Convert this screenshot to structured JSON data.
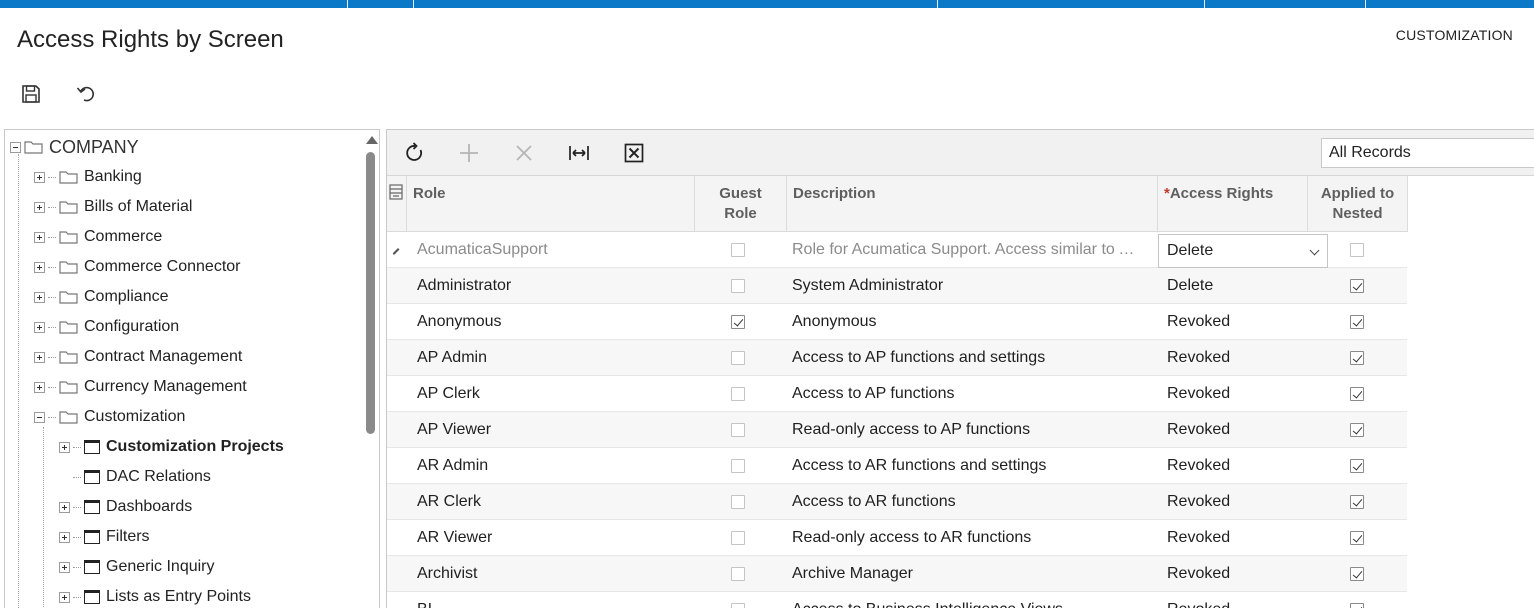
{
  "page": {
    "title": "Access Rights by Screen",
    "customization_label": "CUSTOMIZATION"
  },
  "tree": {
    "root": "COMPANY",
    "items": [
      {
        "label": "Banking"
      },
      {
        "label": "Bills of Material"
      },
      {
        "label": "Commerce"
      },
      {
        "label": "Commerce Connector"
      },
      {
        "label": "Compliance"
      },
      {
        "label": "Configuration"
      },
      {
        "label": "Contract Management"
      },
      {
        "label": "Currency Management"
      },
      {
        "label": "Customization"
      },
      {
        "label": "Customization Projects"
      },
      {
        "label": "DAC Relations"
      },
      {
        "label": "Dashboards"
      },
      {
        "label": "Filters"
      },
      {
        "label": "Generic Inquiry"
      },
      {
        "label": "Lists as Entry Points"
      }
    ]
  },
  "grid": {
    "filter": "All Records",
    "columns": {
      "role": "Role",
      "guest_role": "Guest Role",
      "description": "Description",
      "access_rights": "Access Rights",
      "applied_to_nested": "Applied to Nested"
    },
    "rows": [
      {
        "role": "AcumaticaSupport",
        "guest": false,
        "description": "Role for Acumatica Support. Access similar to Administrator",
        "access": "Delete",
        "nested": false
      },
      {
        "role": "Administrator",
        "guest": false,
        "description": "System Administrator",
        "access": "Delete",
        "nested": true
      },
      {
        "role": "Anonymous",
        "guest": true,
        "description": "Anonymous",
        "access": "Revoked",
        "nested": true
      },
      {
        "role": "AP Admin",
        "guest": false,
        "description": "Access to AP functions and settings",
        "access": "Revoked",
        "nested": true
      },
      {
        "role": "AP Clerk",
        "guest": false,
        "description": "Access to AP functions",
        "access": "Revoked",
        "nested": true
      },
      {
        "role": "AP Viewer",
        "guest": false,
        "description": "Read-only access to AP functions",
        "access": "Revoked",
        "nested": true
      },
      {
        "role": "AR Admin",
        "guest": false,
        "description": "Access to AR functions and settings",
        "access": "Revoked",
        "nested": true
      },
      {
        "role": "AR Clerk",
        "guest": false,
        "description": "Access to AR functions",
        "access": "Revoked",
        "nested": true
      },
      {
        "role": "AR Viewer",
        "guest": false,
        "description": "Read-only access to AR functions",
        "access": "Revoked",
        "nested": true
      },
      {
        "role": "Archivist",
        "guest": false,
        "description": "Archive Manager",
        "access": "Revoked",
        "nested": true
      },
      {
        "role": "BI",
        "guest": false,
        "description": "Access to Business Intelligence Views",
        "access": "Revoked",
        "nested": true
      }
    ]
  }
}
